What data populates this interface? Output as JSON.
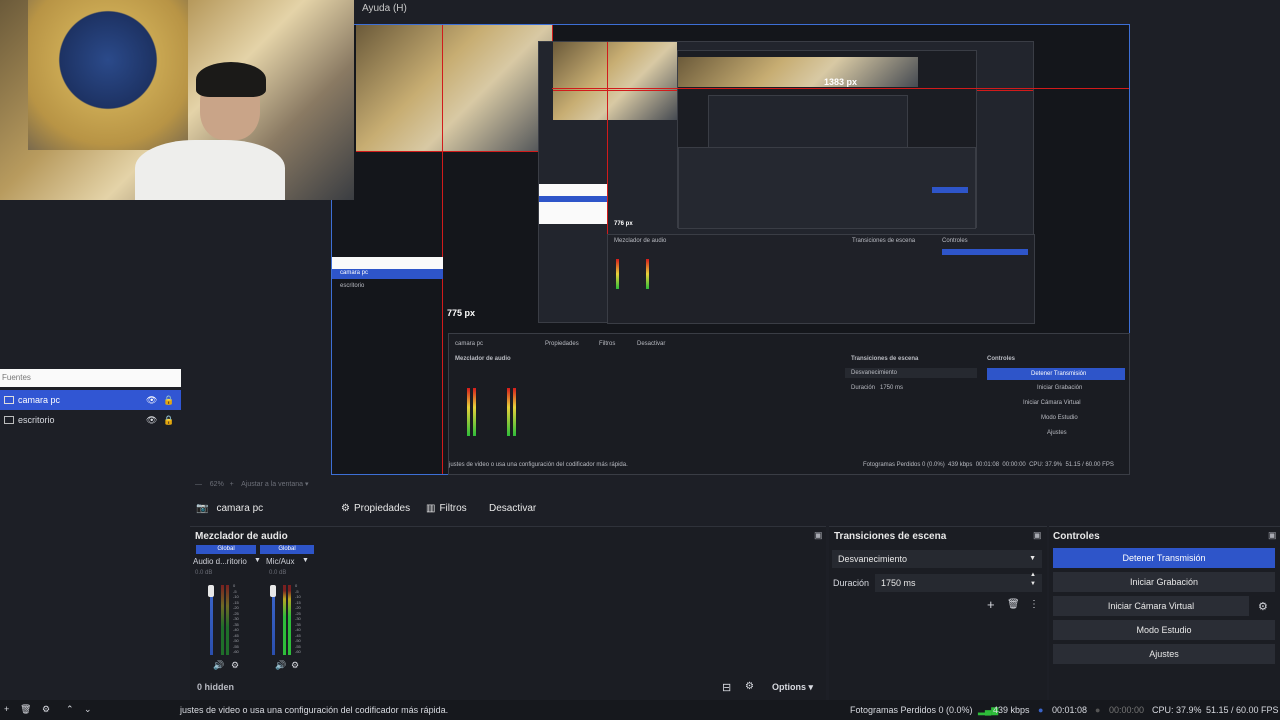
{
  "menu": {
    "help": "Ayuda (H)"
  },
  "preview_overlay": {
    "height_label": "775 px",
    "width_label": "1383 px",
    "nested_height_label": "776 px"
  },
  "sources": {
    "header": "Fuentes",
    "items": [
      {
        "label": "camara pc",
        "selected": true,
        "icon": "camera-icon"
      },
      {
        "label": "escritorio",
        "selected": false,
        "icon": "monitor-icon"
      }
    ]
  },
  "preview_toolbar": {
    "zoom": "62%",
    "fit": "Ajustar a la ventana"
  },
  "source_toolbar": {
    "source_name": "camara pc",
    "properties": "Propiedades",
    "filters": "Filtros",
    "deactivate": "Desactivar"
  },
  "mixer": {
    "title": "Mezclador de audio",
    "tracks": [
      {
        "badge": "Global",
        "name": "Audio d...ritorio",
        "db": "0.0 dB"
      },
      {
        "badge": "Global",
        "name": "Mic/Aux",
        "db": "0.0 dB"
      }
    ],
    "scale": [
      "0",
      "-5",
      "-10",
      "-15",
      "-20",
      "-25",
      "-30",
      "-35",
      "-40",
      "-45",
      "-50",
      "-55",
      "-60"
    ],
    "hidden": "0 hidden",
    "options": "Options"
  },
  "transitions": {
    "title": "Transiciones de escena",
    "selected": "Desvanecimiento",
    "duration_label": "Duración",
    "duration_value": "1750 ms"
  },
  "controls": {
    "title": "Controles",
    "stop_stream": "Detener Transmisión",
    "start_record": "Iniciar Grabación",
    "virtual_cam": "Iniciar Cámara Virtual",
    "studio_mode": "Modo Estudio",
    "settings": "Ajustes"
  },
  "status": {
    "message": "justes de video o usa una configuración del codificador más rápida.",
    "dropped": "Fotogramas Perdidos 0 (0.0%)",
    "bitrate": "439 kbps",
    "stream_time": "00:01:08",
    "rec_time": "00:00:00",
    "cpu": "CPU: 37.9%",
    "fps": "51.15 / 60.00 FPS"
  },
  "colors": {
    "accent": "#2e55c9",
    "background": "#1d1f26",
    "recording_red": "#d11b1b"
  }
}
